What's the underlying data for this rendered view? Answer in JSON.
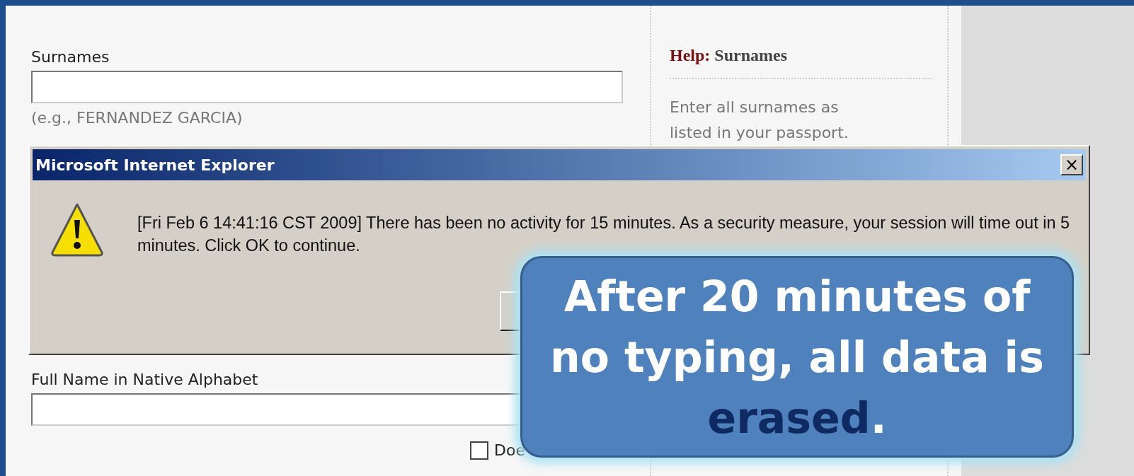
{
  "form": {
    "surnames": {
      "label": "Surnames",
      "hint": "(e.g., FERNANDEZ GARCIA)"
    },
    "native_name": {
      "label": "Full Name in Native Alphabet"
    },
    "checkbox": {
      "label": "Doe",
      "checked": false
    }
  },
  "help": {
    "prefix": "Help:",
    "title": "Surnames",
    "text": "Enter all surnames as listed in your passport."
  },
  "dialog": {
    "title": "Microsoft Internet Explorer",
    "close": "×",
    "message": "[Fri Feb 6 14:41:16 CST 2009] There has been no activity for 15 minutes. As a security measure, your session will time out in 5 minutes. Click OK to continue."
  },
  "callout": {
    "parts": [
      {
        "text": "After 20 minutes of no typing, all data is ",
        "emphasis": false
      },
      {
        "text": "erased",
        "emphasis": true
      },
      {
        "text": ".",
        "emphasis": false
      }
    ]
  }
}
